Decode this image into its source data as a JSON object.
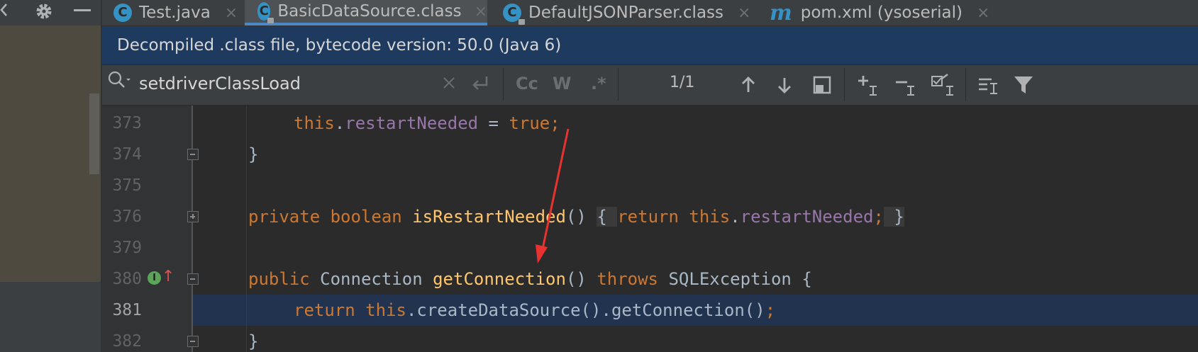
{
  "tabs": [
    {
      "label": "Test.java",
      "icon": "c-class-icon",
      "active": false
    },
    {
      "label": "BasicDataSource.class",
      "icon": "c-class-locked-icon",
      "active": true
    },
    {
      "label": "DefaultJSONParser.class",
      "icon": "c-class-locked-icon",
      "active": false
    },
    {
      "label": "pom.xml (ysoserial)",
      "icon": "maven-icon",
      "active": false
    }
  ],
  "tab_icon_letters": {
    "class": "C",
    "maven": "m"
  },
  "close_glyph": "×",
  "banner": {
    "text": "Decompiled .class file, bytecode version: 50.0 (Java 6)"
  },
  "find": {
    "query": "setdriverClassLoad",
    "match_case_label": "Cc",
    "words_label": "W",
    "regex_label": ".*",
    "count": "1/1"
  },
  "lines": [
    {
      "number": "373"
    },
    {
      "number": "374"
    },
    {
      "number": "375"
    },
    {
      "number": "376"
    },
    {
      "number": "379"
    },
    {
      "number": "380"
    },
    {
      "number": "381"
    },
    {
      "number": "382"
    }
  ],
  "code": {
    "l373": {
      "kw_this": "this",
      "dot": ".",
      "field": "restartNeeded",
      "eq": " = ",
      "kw_true": "true",
      "semi": ";"
    },
    "l374": {
      "brace": "}"
    },
    "l376": {
      "kw_private": "private",
      "kw_boolean": "boolean",
      "method": "isRestartNeeded",
      "parens": "()",
      "open": "{",
      "kw_return": "return",
      "kw_this": "this",
      "dot": ".",
      "field": "restartNeeded",
      "semi": ";",
      "close": "}"
    },
    "l380": {
      "kw_public": "public",
      "type": "Connection",
      "method": "getConnection",
      "parens": "()",
      "kw_throws": "throws",
      "exc": "SQLException",
      "open": "{"
    },
    "l381": {
      "kw_return": "return",
      "kw_this": "this",
      "rest": ".createDataSource().getConnection()",
      "semi": ";"
    },
    "l382": {
      "brace": "}"
    }
  },
  "gutter_marker": {
    "letter": "I",
    "arrow": "↑"
  },
  "colors": {
    "accent": "#4a88c7",
    "banner_bg": "#1e3a5f",
    "annotation_arrow": "#e8322f"
  }
}
